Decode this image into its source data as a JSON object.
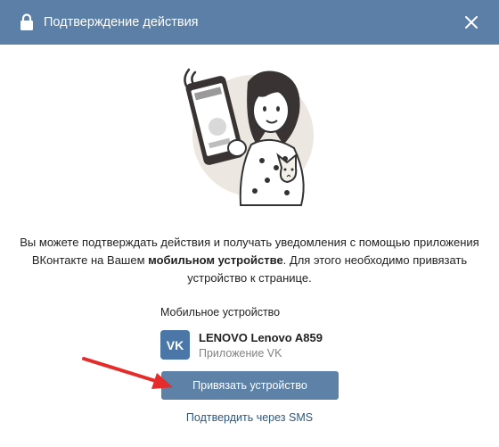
{
  "dialog": {
    "title": "Подтверждение действия",
    "header_color": "#5b7fa6",
    "icons": {
      "lock": "lock-icon",
      "close": "close-icon"
    }
  },
  "description": {
    "part1": "Вы можете подтверждать действия и получать уведомления с помощью приложения ВКонтакте на Вашем ",
    "bold": "мобильном устройстве",
    "part2": ". Для этого необходимо привязать устройство к странице."
  },
  "device_section": {
    "label": "Мобильное устройство",
    "device_name": "LENOVO Lenovo A859",
    "device_app": "Приложение VK",
    "app_logo_text": "VK"
  },
  "actions": {
    "bind_button": "Привязать устройство",
    "sms_link": "Подтвердить через SMS"
  },
  "colors": {
    "accent": "#5e81a8",
    "link": "#2a5885",
    "arrow": "#e62b2b"
  }
}
